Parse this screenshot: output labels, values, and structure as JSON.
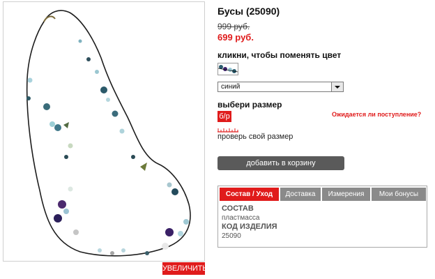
{
  "product": {
    "title": "Бусы (25090)",
    "old_price": "999 руб.",
    "new_price": "699 руб.",
    "zoom_label": "УВЕЛИЧИТЬ"
  },
  "color": {
    "label": "кликни, чтобы поменять цвет",
    "selected": "синий"
  },
  "size": {
    "label": "выбери размер",
    "value": "б/р",
    "availability": "Ожидается ли поступление?",
    "check_link": "проверь свой размер"
  },
  "cart": {
    "button_label": "добавить в корзину"
  },
  "tabs": [
    {
      "label": "Состав / Уход",
      "active": true
    },
    {
      "label": "Доставка",
      "active": false
    },
    {
      "label": "Измерения",
      "active": false
    },
    {
      "label": "Мои бонусы",
      "active": false
    }
  ],
  "details": {
    "composition_heading": "СОСТАВ",
    "composition_value": "пластмасса",
    "code_heading": "КОД ИЗДЕЛИЯ",
    "code_value": "25090"
  },
  "colors": {
    "accent": "#e01b1b",
    "tab_inactive": "#8a8a8a",
    "cart_button": "#5a5a5a"
  }
}
